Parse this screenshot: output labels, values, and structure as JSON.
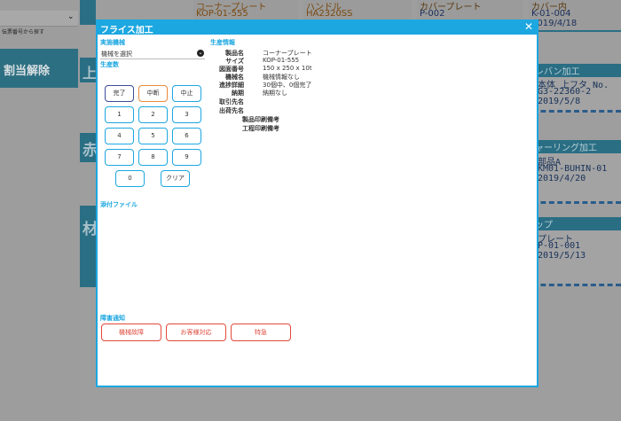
{
  "background": {
    "left_panel": {
      "select_arrow": "⌄",
      "hint": "伝票番号から探す",
      "release_button": "割当解除"
    },
    "column_headers": [
      "上",
      "赤",
      "材"
    ],
    "top_items": [
      {
        "name": "コーナープレート",
        "code": "KOP-01-555"
      },
      {
        "name": "ハンドル",
        "code": "HA2320SS"
      },
      {
        "name": "カバープレート",
        "code": "P-002"
      },
      {
        "name": "カバー内",
        "code": "K-01-004",
        "date": "2019/4/18"
      }
    ],
    "cards": [
      {
        "header": "レバン加工",
        "lines": [
          "本体 上フタ No.",
          "G3-22360-2",
          "2019/5/8"
        ]
      },
      {
        "header": "ャーリング加工",
        "lines": [
          "部品A",
          "KM01-BUHIN-01",
          "2019/4/20"
        ]
      },
      {
        "header": "ップ",
        "lines": [
          "プレート",
          "P-01-001",
          "2019/5/13"
        ]
      }
    ]
  },
  "modal": {
    "title": "フライス加工",
    "close_icon": "✕",
    "machine_section": {
      "label": "実施機械",
      "select_value": "機械を選択"
    },
    "production_label": "生産数",
    "status_buttons": {
      "done": "完了",
      "pause": "中断",
      "stop": "中止"
    },
    "keypad": {
      "keys": [
        "1",
        "2",
        "3",
        "4",
        "5",
        "6",
        "7",
        "8",
        "9"
      ],
      "zero": "0",
      "clear": "クリア"
    },
    "attachments_label": "添付ファイル",
    "production_info": {
      "label": "生産情報",
      "rows": [
        {
          "key": "製品名",
          "value": "コーナープレート"
        },
        {
          "key": "サイズ",
          "value": "KOP-01-555"
        },
        {
          "key": "図面番号",
          "value": "150 x 250 x 10t"
        },
        {
          "key": "機械名",
          "value": "機械情報なし"
        },
        {
          "key": "進捗詳細",
          "value": "30個中、0個完了"
        },
        {
          "key": "納期",
          "value": "納期なし"
        },
        {
          "key": "取引先名",
          "value": ""
        },
        {
          "key": "出荷先名",
          "value": ""
        },
        {
          "key": "製品印刷備考",
          "value": "-"
        },
        {
          "key": "工程印刷備考",
          "value": "-"
        }
      ]
    },
    "issue_section": {
      "label": "障害通知",
      "buttons": [
        "機械故障",
        "お客様対応",
        "特急"
      ]
    }
  }
}
